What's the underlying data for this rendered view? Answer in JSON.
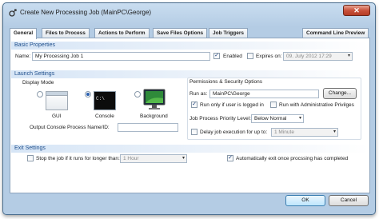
{
  "window": {
    "title": "Create New Processing Job (MainPC\\George)",
    "close_glyph": "✕"
  },
  "tabs": [
    {
      "label": "General"
    },
    {
      "label": "Files to Process"
    },
    {
      "label": "Actions to Perform"
    },
    {
      "label": "Save Files Options"
    },
    {
      "label": "Job Triggers"
    },
    {
      "label": "Command Line Preview"
    }
  ],
  "basic": {
    "header": "Basic Properties",
    "name_label": "Name:",
    "name_value": "My Processing Job 1",
    "enabled_label": "Enabled",
    "enabled_checked": true,
    "expires_label": "Expires on:",
    "expires_checked": false,
    "expires_value": "09.   July    2012 17:29"
  },
  "launch": {
    "header": "Launch Settings",
    "display_mode_label": "Display Mode",
    "modes": [
      {
        "label": "GUI",
        "selected": false
      },
      {
        "label": "Console",
        "selected": true
      },
      {
        "label": "Background",
        "selected": false
      }
    ],
    "console_glyph": "C:\\",
    "output_label": "Output Console Process Name/ID:",
    "output_value": "",
    "perm_header": "Permissions & Security Options",
    "run_as_label": "Run as:",
    "run_as_value": "MainPC\\George",
    "change_label": "Change...",
    "run_logged_label": "Run only if user is logged in",
    "run_logged_checked": true,
    "run_admin_label": "Run with Administrative Privilges",
    "run_admin_checked": false,
    "priority_label": "Job Process Priority Level:",
    "priority_value": "Below Normal",
    "delay_label": "Delay job execution for up to:",
    "delay_checked": false,
    "delay_value": "1 Minute"
  },
  "exit": {
    "header": "Exit Settings",
    "stop_label": "Stop the job if it runs for longer than:",
    "stop_checked": false,
    "stop_value": "1 Hour",
    "auto_exit_label": "Automatically exit once procssing has completed",
    "auto_exit_checked": true
  },
  "footer": {
    "ok_label": "OK",
    "cancel_label": "Cancel"
  },
  "check_glyph": "✓",
  "dropdown_glyph": "▾"
}
